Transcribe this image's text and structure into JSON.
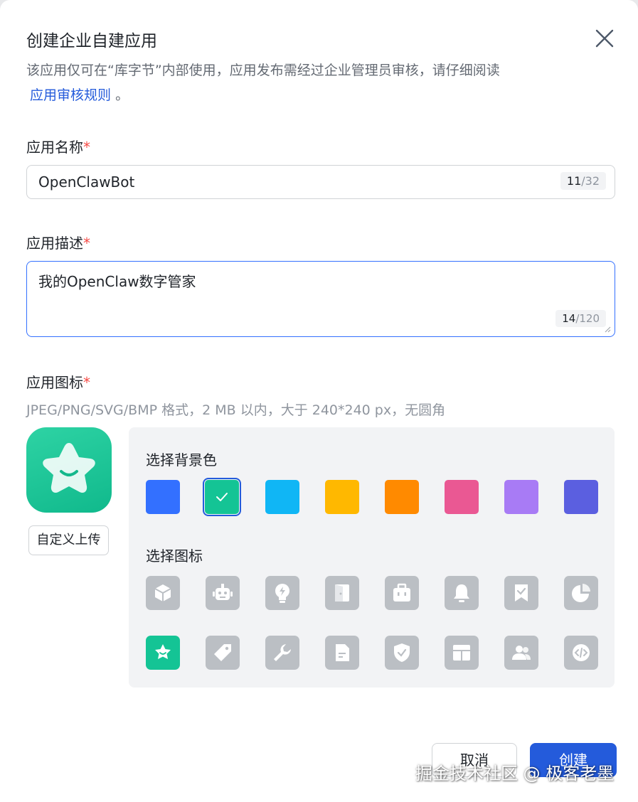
{
  "dialog": {
    "title": "创建企业自建应用",
    "description": "该应用仅可在“库字节”内部使用，应用发布需经过企业管理员审核，请仔细阅读",
    "link_text": "应用审核规则",
    "link_suffix": "。"
  },
  "form": {
    "name_label": "应用名称",
    "name_value": "OpenClawBot",
    "name_count": "11",
    "name_max": "/32",
    "desc_label": "应用描述",
    "desc_value": "我的OpenClaw数字管家",
    "desc_count": "14",
    "desc_max": "/120",
    "icon_label": "应用图标",
    "icon_hint": "JPEG/PNG/SVG/BMP 格式，2 MB 以内，大于 240*240 px，无圆角",
    "required_mark": "*",
    "upload_label": "自定义上传"
  },
  "picker": {
    "bg_title": "选择背景色",
    "icon_title": "选择图标",
    "colors": [
      "#3370ff",
      "#14c495",
      "#10b6f5",
      "#ffb800",
      "#ff8a00",
      "#ea5893",
      "#a87bf5",
      "#5b5fe0"
    ],
    "selected_color": 1,
    "icons_row1": [
      "cube-icon",
      "robot-icon",
      "lightbulb-icon",
      "door-icon",
      "briefcase-icon",
      "bell-icon",
      "bookmark-icon",
      "pie-chart-icon"
    ],
    "icons_row2": [
      "star-icon",
      "tag-icon",
      "wrench-icon",
      "document-icon",
      "shield-icon",
      "layout-icon",
      "people-icon",
      "code-icon"
    ],
    "selected_icon": "star-icon"
  },
  "footer": {
    "cancel_label": "取消",
    "create_label": "创建"
  },
  "watermark": "掘金技术社区 @ 极客老墨"
}
